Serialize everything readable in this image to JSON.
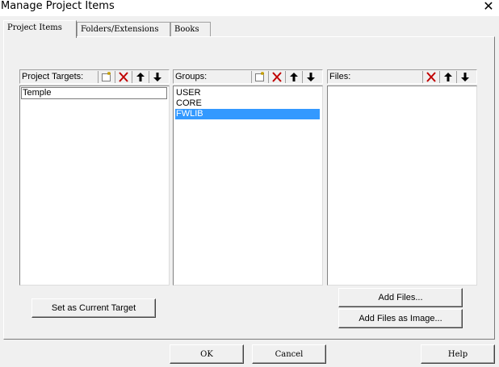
{
  "window": {
    "title": "Manage Project Items",
    "close_glyph": "✕"
  },
  "tabs": [
    {
      "label": "Project Items",
      "active": true
    },
    {
      "label": "Folders/Extensions",
      "active": false
    },
    {
      "label": "Books",
      "active": false
    }
  ],
  "project_targets": {
    "label": "Project Targets:",
    "edit_value": "Temple",
    "toolbar": [
      "new-icon",
      "delete-icon",
      "move-up-icon",
      "move-down-icon"
    ]
  },
  "groups": {
    "label": "Groups:",
    "items": [
      "USER",
      "CORE",
      "FWLIB"
    ],
    "selected": "FWLIB",
    "toolbar": [
      "new-icon",
      "delete-icon",
      "move-up-icon",
      "move-down-icon"
    ]
  },
  "files": {
    "label": "Files:",
    "items": [],
    "toolbar": [
      "delete-icon",
      "move-up-icon",
      "move-down-icon"
    ]
  },
  "buttons": {
    "set_current_target": "Set as Current Target",
    "add_files": "Add Files...",
    "add_files_as_image": "Add Files as Image...",
    "ok": "OK",
    "cancel": "Cancel",
    "help": "Help"
  },
  "colors": {
    "dialog_bg": "#f0f0f0",
    "selection": "#3399ff",
    "delete_red": "#c00000"
  }
}
